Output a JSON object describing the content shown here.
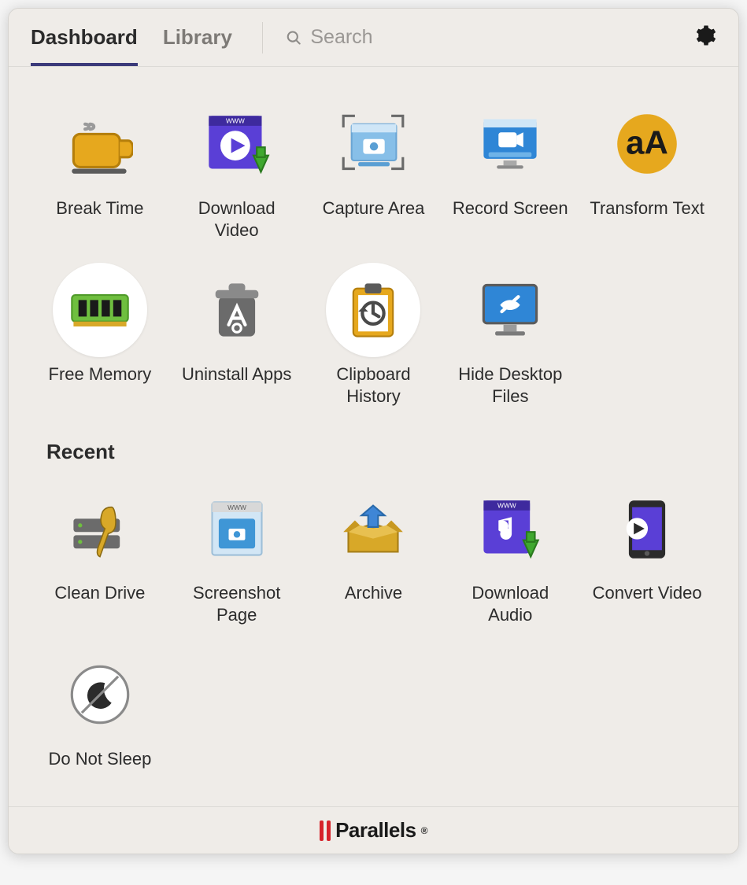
{
  "toolbar": {
    "tabs": [
      {
        "label": "Dashboard",
        "active": true
      },
      {
        "label": "Library",
        "active": false
      }
    ],
    "search_placeholder": "Search"
  },
  "main_tools": [
    {
      "id": "break-time",
      "label": "Break Time",
      "icon": "coffee-icon"
    },
    {
      "id": "download-video",
      "label": "Download Video",
      "icon": "download-video-icon"
    },
    {
      "id": "capture-area",
      "label": "Capture Area",
      "icon": "capture-area-icon"
    },
    {
      "id": "record-screen",
      "label": "Record Screen",
      "icon": "record-screen-icon"
    },
    {
      "id": "transform-text",
      "label": "Transform Text",
      "icon": "transform-text-icon"
    },
    {
      "id": "free-memory",
      "label": "Free Memory",
      "icon": "ram-icon",
      "circle": true
    },
    {
      "id": "uninstall-apps",
      "label": "Uninstall Apps",
      "icon": "trash-app-icon"
    },
    {
      "id": "clipboard-history",
      "label": "Clipboard History",
      "icon": "clipboard-history-icon",
      "circle": true
    },
    {
      "id": "hide-desktop-files",
      "label": "Hide Desktop Files",
      "icon": "hide-desktop-icon"
    }
  ],
  "recent": {
    "title": "Recent",
    "tools": [
      {
        "id": "clean-drive",
        "label": "Clean Drive",
        "icon": "clean-drive-icon"
      },
      {
        "id": "screenshot-page",
        "label": "Screenshot Page",
        "icon": "screenshot-page-icon"
      },
      {
        "id": "archive",
        "label": "Archive",
        "icon": "archive-icon"
      },
      {
        "id": "download-audio",
        "label": "Download Audio",
        "icon": "download-audio-icon"
      },
      {
        "id": "convert-video",
        "label": "Convert Video",
        "icon": "convert-video-icon"
      },
      {
        "id": "do-not-sleep",
        "label": "Do Not Sleep",
        "icon": "do-not-sleep-icon",
        "circle_outline": true
      }
    ]
  },
  "footer": {
    "brand": "Parallels"
  }
}
